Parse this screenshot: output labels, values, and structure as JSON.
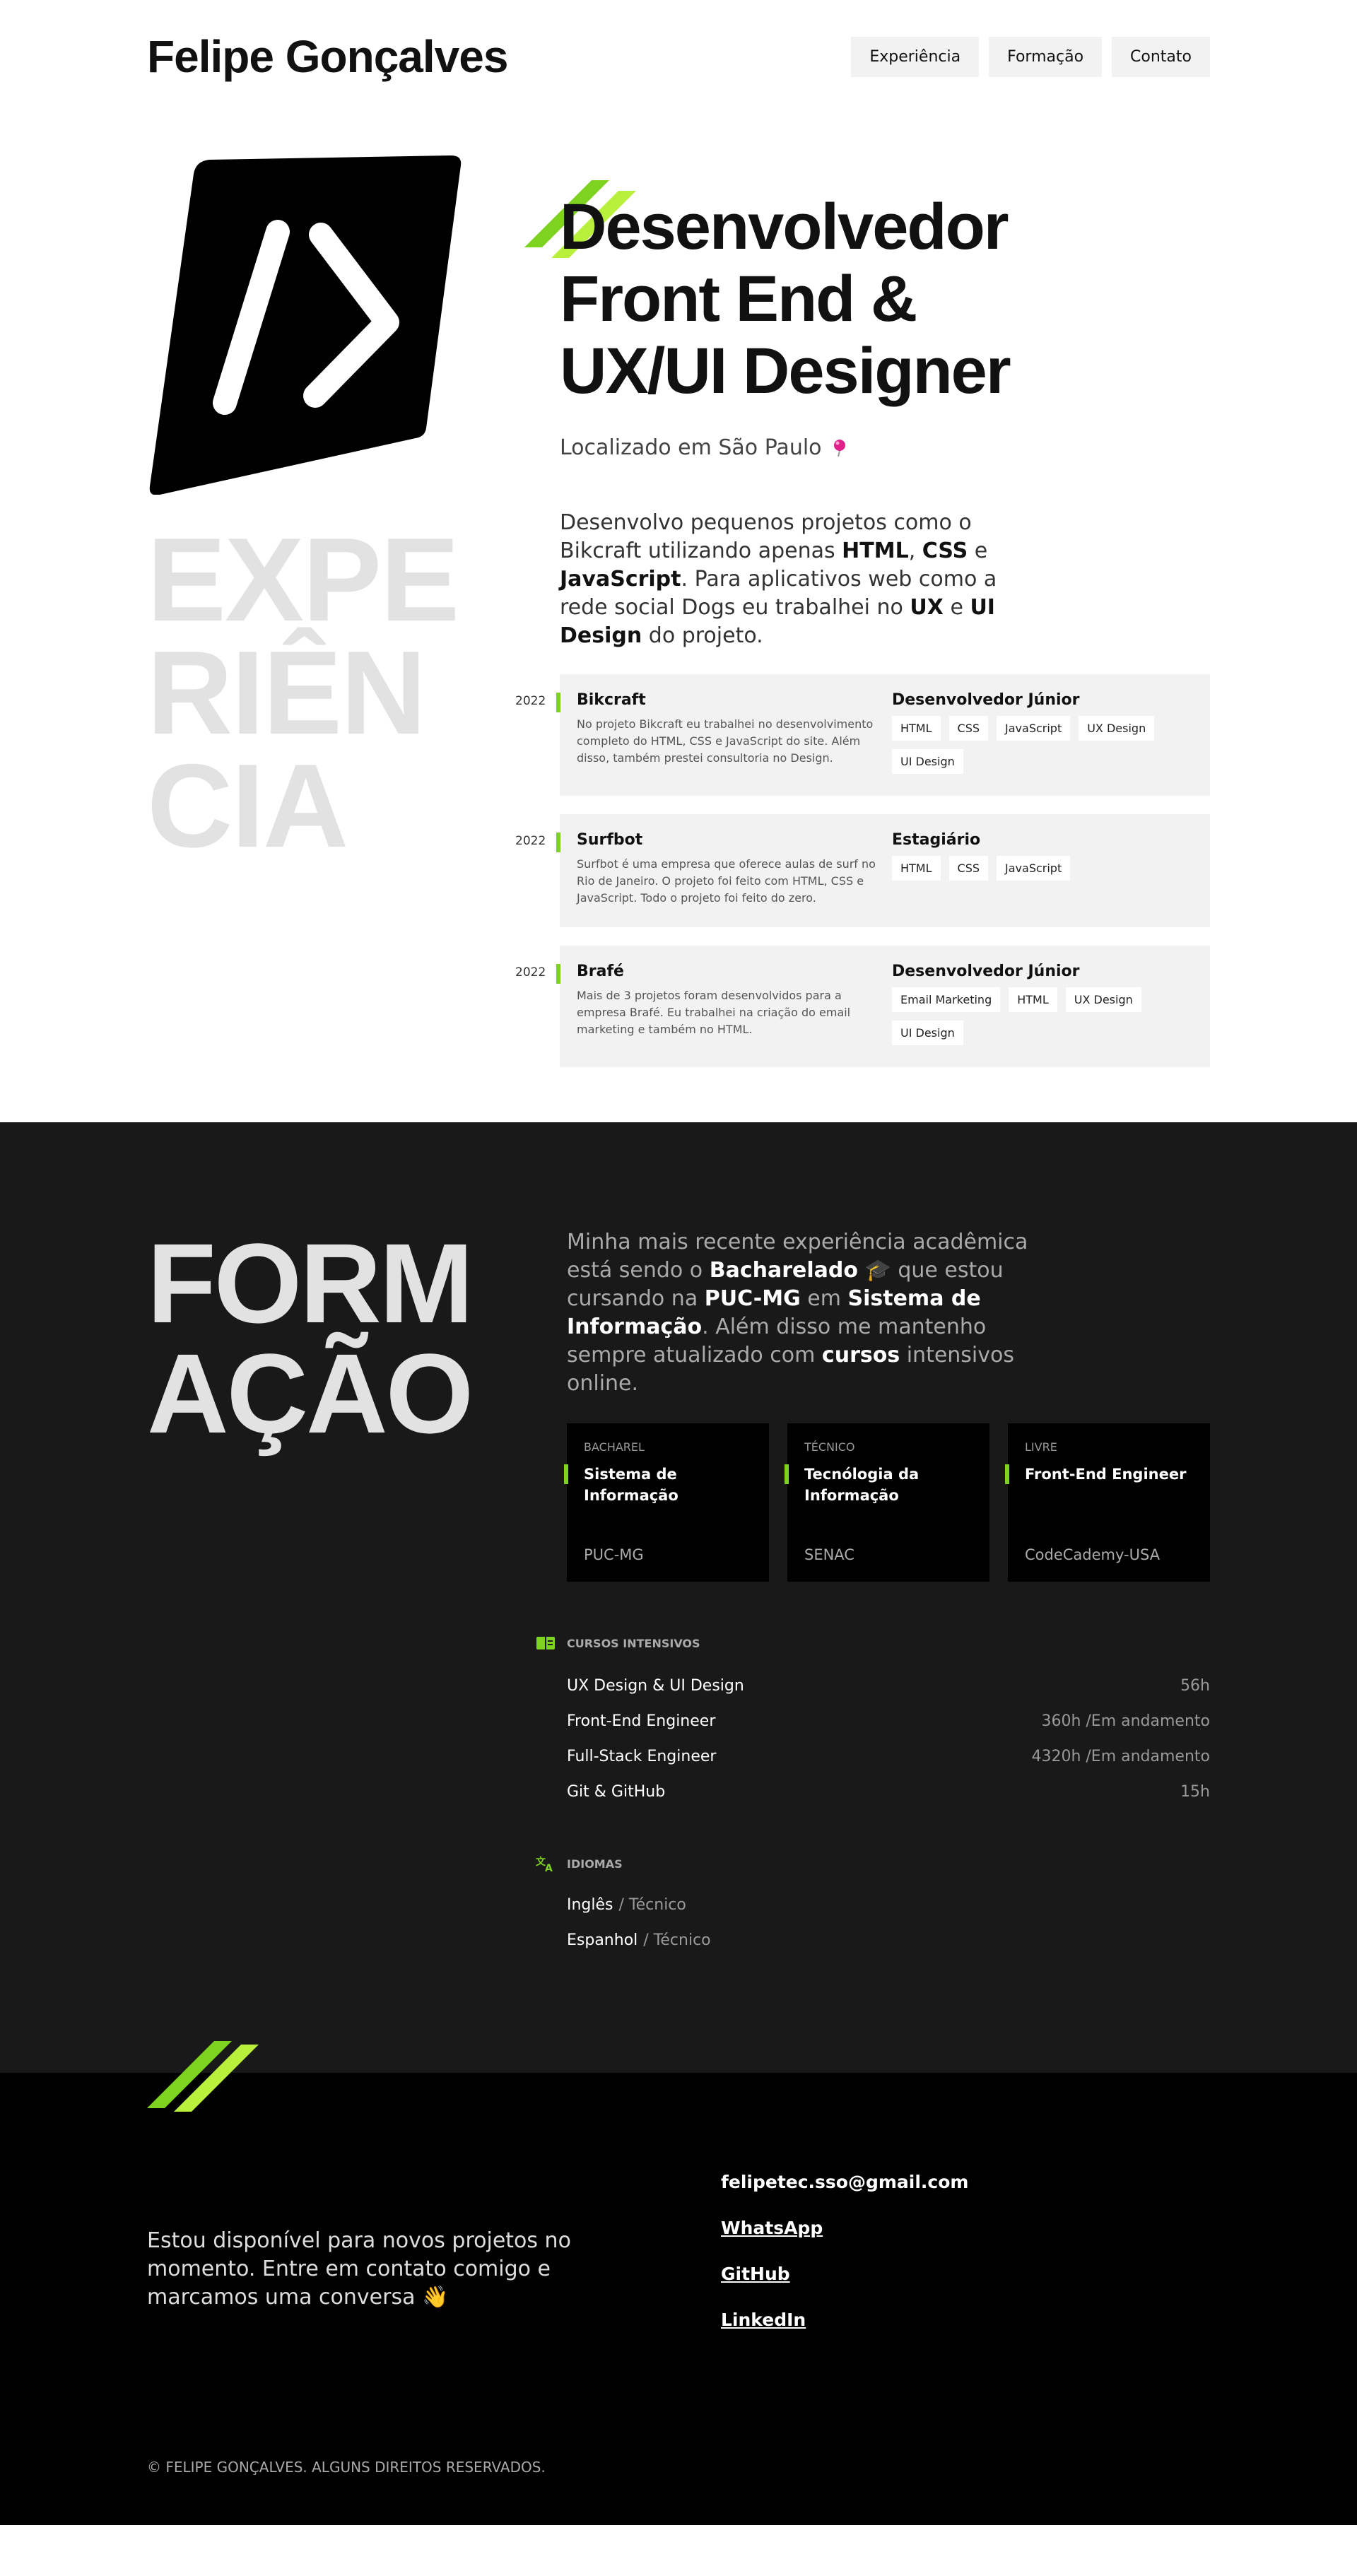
{
  "header": {
    "brand": "Felipe Gonçalves",
    "nav": [
      "Experiência",
      "Formação",
      "Contato"
    ]
  },
  "hero": {
    "title_line1": "Desenvolvedor",
    "title_line2": "Front End &",
    "title_line3": "UX/UI Designer",
    "location": "Localizado em São Paulo",
    "location_icon": "pin-icon"
  },
  "experience": {
    "heading_line1": "EXPE",
    "heading_line2": "RIÊN",
    "heading_line3": "CIA",
    "intro_parts": [
      "Desenvolvo pequenos projetos como o Bikcraft utilizando apenas ",
      "HTML",
      ", ",
      "CSS",
      " e ",
      "JavaScript",
      ". Para aplicativos web como a rede social Dogs eu trabalhei no ",
      "UX",
      " e ",
      "UI Design",
      " do projeto."
    ],
    "jobs": [
      {
        "year": "2022",
        "name": "Bikcraft",
        "description": "No projeto Bikcraft eu trabalhei no desenvolvimento completo do HTML, CSS e JavaScript do site. Além disso, também prestei consultoria no Design.",
        "role": "Desenvolvedor Júnior",
        "tags": [
          "HTML",
          "CSS",
          "JavaScript",
          "UX Design",
          "UI Design"
        ]
      },
      {
        "year": "2022",
        "name": "Surfbot",
        "description": "Surfbot é uma empresa que oferece aulas de surf no Rio de Janeiro. O projeto foi feito com HTML, CSS e JavaScript. Todo o projeto foi feito do zero.",
        "role": "Estagiário",
        "tags": [
          "HTML",
          "CSS",
          "JavaScript"
        ]
      },
      {
        "year": "2022",
        "name": "Brafé",
        "description": "Mais de 3 projetos foram desenvolvidos para a empresa Brafé. Eu trabalhei na criação do email marketing e também no HTML.",
        "role": "Desenvolvedor Júnior",
        "tags": [
          "Email Marketing",
          "HTML",
          "UX Design",
          "UI Design"
        ]
      }
    ]
  },
  "education": {
    "heading_line1": "FORM",
    "heading_line2": "AÇÃO",
    "intro_parts": [
      "Minha mais recente experiência acadêmica está sendo o ",
      "Bacharelado",
      " 🎓 que estou cursando na ",
      "PUC-MG",
      " em ",
      "Sistema de Informação",
      ". Além disso me mantenho sempre atualizado com ",
      "cursos",
      " intensivos online."
    ],
    "cards": [
      {
        "type": "BACHAREL",
        "name": "Sistema de Informação",
        "institution": "PUC-MG"
      },
      {
        "type": "TÉCNICO",
        "name": "Tecnólogia da Informação",
        "institution": "SENAC"
      },
      {
        "type": "LIVRE",
        "name": "Front-End Engineer",
        "institution": "CodeCademy-USA"
      }
    ],
    "courses_title": "CURSOS INTENSIVOS",
    "courses": [
      {
        "name": "UX Design & UI Design",
        "hours": "56h"
      },
      {
        "name": "Front-End Engineer",
        "hours": "360h /Em andamento"
      },
      {
        "name": "Full-Stack Engineer",
        "hours": "4320h /Em andamento"
      },
      {
        "name": "Git & GitHub",
        "hours": "15h"
      }
    ],
    "languages_title": "IDIOMAS",
    "languages": [
      {
        "name": "Inglês",
        "level": "/ Técnico"
      },
      {
        "name": "Espanhol",
        "level": "/ Técnico"
      }
    ]
  },
  "contact": {
    "text": "Estou disponível para novos projetos no momento. Entre em contato comigo e marcamos uma conversa 👋",
    "email": "felipetec.sso@gmail.com",
    "links": [
      "WhatsApp",
      "GitHub",
      "LinkedIn"
    ],
    "copyright": "© FELIPE GONÇALVES. ALGUNS DIREITOS RESERVADOS."
  },
  "colors": {
    "accent_green": "#7ed321",
    "accent_lime": "#b8f03c",
    "dark_bg": "#191919",
    "footer_bg": "#000000",
    "pin_pink": "#e0218a"
  }
}
